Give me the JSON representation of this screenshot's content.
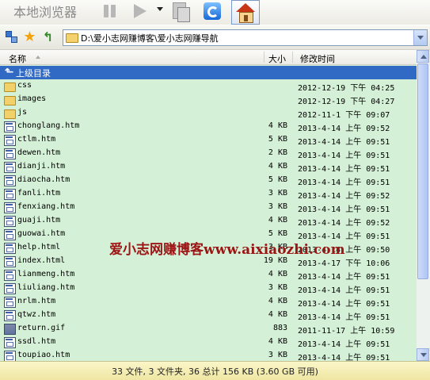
{
  "toolbar": {
    "title": "本地浏览器",
    "icons": [
      "pause-icon",
      "play-icon",
      "dropdown-icon",
      "copy-icon",
      "refresh-icon",
      "home-icon"
    ]
  },
  "address": {
    "path": "D:\\爱小志网赚博客\\爱小志网赚导航"
  },
  "columns": {
    "name": "名称",
    "size": "大小",
    "modified": "修改时间"
  },
  "rows": [
    {
      "name": "上级目录",
      "size": "",
      "date": "",
      "type": "up"
    },
    {
      "name": "css",
      "size": "",
      "date": "2012-12-19 下午 04:25",
      "type": "folder"
    },
    {
      "name": "images",
      "size": "",
      "date": "2012-12-19 下午 04:27",
      "type": "folder"
    },
    {
      "name": "js",
      "size": "",
      "date": "2012-11-1 下午 09:07",
      "type": "folder"
    },
    {
      "name": "chonglang.htm",
      "size": "4 KB",
      "date": "2013-4-14 上午 09:52",
      "type": "html"
    },
    {
      "name": "ctlm.htm",
      "size": "5 KB",
      "date": "2013-4-14 上午 09:51",
      "type": "html"
    },
    {
      "name": "dewen.htm",
      "size": "2 KB",
      "date": "2013-4-14 上午 09:51",
      "type": "html"
    },
    {
      "name": "dianji.htm",
      "size": "4 KB",
      "date": "2013-4-14 上午 09:51",
      "type": "html"
    },
    {
      "name": "diaocha.htm",
      "size": "5 KB",
      "date": "2013-4-14 上午 09:51",
      "type": "html"
    },
    {
      "name": "fanli.htm",
      "size": "3 KB",
      "date": "2013-4-14 上午 09:52",
      "type": "html"
    },
    {
      "name": "fenxiang.htm",
      "size": "3 KB",
      "date": "2013-4-14 上午 09:51",
      "type": "html"
    },
    {
      "name": "guaji.htm",
      "size": "4 KB",
      "date": "2013-4-14 上午 09:52",
      "type": "html"
    },
    {
      "name": "guowai.htm",
      "size": "5 KB",
      "date": "2013-4-14 上午 09:51",
      "type": "html"
    },
    {
      "name": "help.html",
      "size": "3 KB",
      "date": "2013-4-14 上午 09:50",
      "type": "html"
    },
    {
      "name": "index.html",
      "size": "19 KB",
      "date": "2013-4-17 下午 10:06",
      "type": "html"
    },
    {
      "name": "lianmeng.htm",
      "size": "4 KB",
      "date": "2013-4-14 上午 09:51",
      "type": "html"
    },
    {
      "name": "liuliang.htm",
      "size": "3 KB",
      "date": "2013-4-14 上午 09:51",
      "type": "html"
    },
    {
      "name": "nrlm.htm",
      "size": "4 KB",
      "date": "2013-4-14 上午 09:51",
      "type": "html"
    },
    {
      "name": "qtwz.htm",
      "size": "4 KB",
      "date": "2013-4-14 上午 09:51",
      "type": "html"
    },
    {
      "name": "return.gif",
      "size": "883",
      "date": "2011-11-17 上午 10:59",
      "type": "gif"
    },
    {
      "name": "ssdl.htm",
      "size": "4 KB",
      "date": "2013-4-14 上午 09:51",
      "type": "html"
    },
    {
      "name": "toupiao.htm",
      "size": "3 KB",
      "date": "2013-4-14 上午 09:51",
      "type": "html"
    }
  ],
  "watermark": "爱小志网赚博客www.aixiaozhi.com",
  "status": "33 文件, 3 文件夹, 36 总计 156 KB (3.60 GB 可用)",
  "colors": {
    "list_bg": "#d4f0d6",
    "selection": "#316ac5",
    "status_bg": "#f3ecb0",
    "watermark": "#9c1515"
  }
}
